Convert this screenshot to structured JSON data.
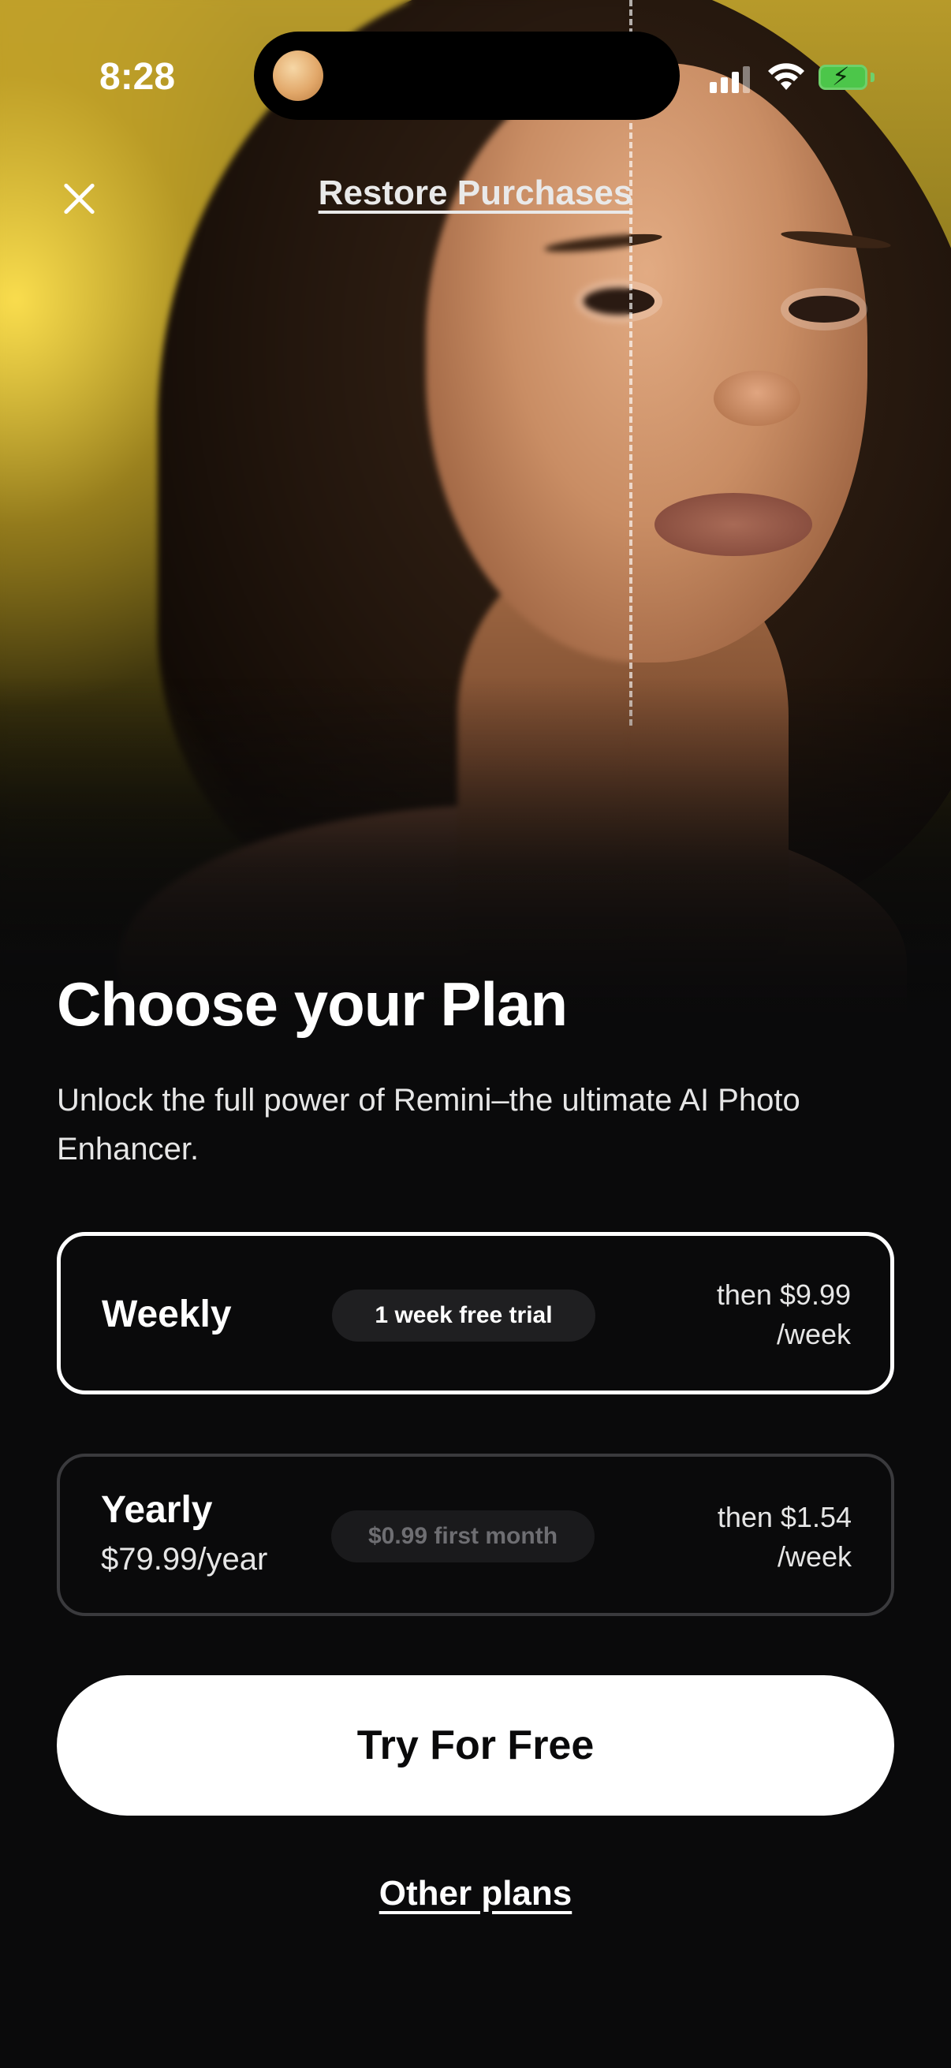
{
  "status_bar": {
    "time": "8:28",
    "icons": [
      "signal-icon",
      "wifi-icon",
      "battery-charging-icon"
    ]
  },
  "header": {
    "close_icon": "close-icon",
    "restore_label": "Restore Purchases"
  },
  "content": {
    "title": "Choose your Plan",
    "subtitle": "Unlock the full power of Remini–the ultimate AI Photo Enhancer."
  },
  "plans": [
    {
      "name": "Weekly",
      "sub": "",
      "badge": "1 week free trial",
      "price_line1": "then $9.99",
      "price_line2": "/week",
      "selected": true
    },
    {
      "name": "Yearly",
      "sub": "$79.99/year",
      "badge": "$0.99 first month",
      "price_line1": "then $1.54",
      "price_line2": "/week",
      "selected": false
    }
  ],
  "cta": {
    "label": "Try For Free"
  },
  "footer": {
    "other_plans_label": "Other plans"
  },
  "colors": {
    "background": "#0a0a0b",
    "accent_yellow": "#f5d84a",
    "cta_bg": "#ffffff",
    "selected_border": "#ffffff",
    "unselected_border": "#3a3a3d"
  }
}
